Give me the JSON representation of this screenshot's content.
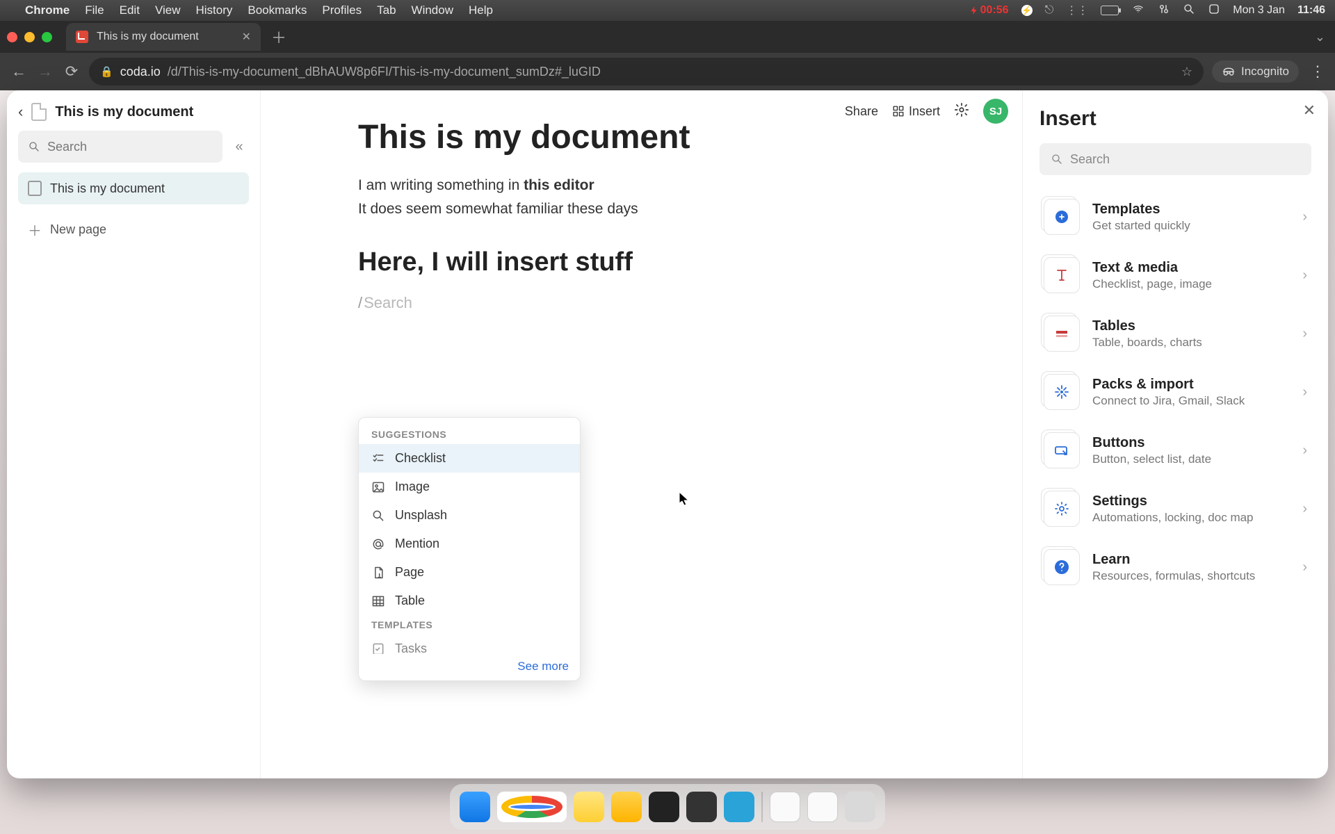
{
  "mac_menu": {
    "app": "Chrome",
    "items": [
      "File",
      "Edit",
      "View",
      "History",
      "Bookmarks",
      "Profiles",
      "Tab",
      "Window",
      "Help"
    ],
    "battery_text": "00:56",
    "date": "Mon 3 Jan",
    "time": "11:46"
  },
  "browser": {
    "tab_title": "This is my document",
    "url_host": "coda.io",
    "url_path": "/d/This-is-my-document_dBhAUW8p6FI/This-is-my-document_sumDz#_luGID",
    "incognito": "Incognito"
  },
  "header": {
    "doc_title": "This is my document",
    "share": "Share",
    "insert": "Insert",
    "avatar": "SJ"
  },
  "sidebar": {
    "search_placeholder": "Search",
    "pages": [
      {
        "label": "This is my document"
      }
    ],
    "new_page": "New page"
  },
  "editor": {
    "title": "This is my document",
    "line1_a": "I am writing something in ",
    "line1_b": "this editor",
    "line2": "It does seem somewhat familiar these days",
    "h2": "Here, I will insert stuff",
    "slash_char": "/",
    "slash_placeholder": "Search"
  },
  "popover": {
    "header1": "SUGGESTIONS",
    "items": [
      {
        "label": "Checklist",
        "icon": "checklist"
      },
      {
        "label": "Image",
        "icon": "image"
      },
      {
        "label": "Unsplash",
        "icon": "search"
      },
      {
        "label": "Mention",
        "icon": "at"
      },
      {
        "label": "Page",
        "icon": "page"
      },
      {
        "label": "Table",
        "icon": "table"
      }
    ],
    "header2": "TEMPLATES",
    "templates": [
      {
        "label": "Tasks",
        "icon": "task"
      }
    ],
    "see_more": "See more"
  },
  "panel": {
    "title": "Insert",
    "search_placeholder": "Search",
    "categories": [
      {
        "title": "Templates",
        "sub": "Get started quickly",
        "icon": "templates"
      },
      {
        "title": "Text & media",
        "sub": "Checklist, page, image",
        "icon": "text"
      },
      {
        "title": "Tables",
        "sub": "Table, boards, charts",
        "icon": "tables"
      },
      {
        "title": "Packs & import",
        "sub": "Connect to Jira, Gmail, Slack",
        "icon": "packs"
      },
      {
        "title": "Buttons",
        "sub": "Button, select list, date",
        "icon": "buttons"
      },
      {
        "title": "Settings",
        "sub": "Automations, locking, doc map",
        "icon": "settings"
      },
      {
        "title": "Learn",
        "sub": "Resources, formulas, shortcuts",
        "icon": "learn"
      }
    ]
  }
}
